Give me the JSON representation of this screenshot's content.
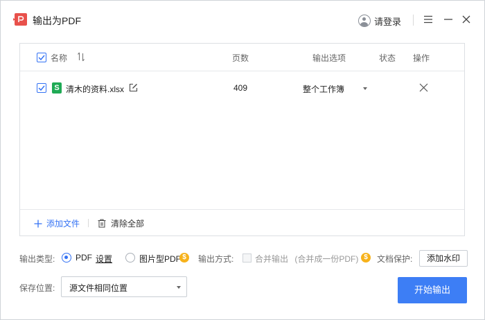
{
  "window": {
    "title": "输出为PDF",
    "login_label": "请登录"
  },
  "table": {
    "headers": {
      "name": "名称",
      "pages": "页数",
      "output_option": "输出选项",
      "status": "状态",
      "action": "操作"
    },
    "rows": [
      {
        "checked": true,
        "file_name": "清木的资料.xlsx",
        "file_type_glyph": "S",
        "pages": "409",
        "output_option": "整个工作簿",
        "status": ""
      }
    ]
  },
  "footer": {
    "add_file": "添加文件",
    "clear_all": "清除全部"
  },
  "options": {
    "output_type_label": "输出类型:",
    "type_pdf": "PDF",
    "settings_link": "设置",
    "type_image_pdf": "图片型PDF",
    "output_mode_label": "输出方式:",
    "merge_output": "合并输出",
    "merge_hint": "(合并成一份PDF)",
    "doc_protect_label": "文档保护:",
    "add_watermark": "添加水印",
    "selected_type": "PDF"
  },
  "save": {
    "label": "保存位置:",
    "location": "源文件相同位置"
  },
  "start_button": "开始输出",
  "colors": {
    "accent": "#3372f4",
    "primary_button": "#3d7ef5",
    "vip_badge": "#f7b21b",
    "xlsx": "#1faa55",
    "app_icon": "#e8514b"
  }
}
